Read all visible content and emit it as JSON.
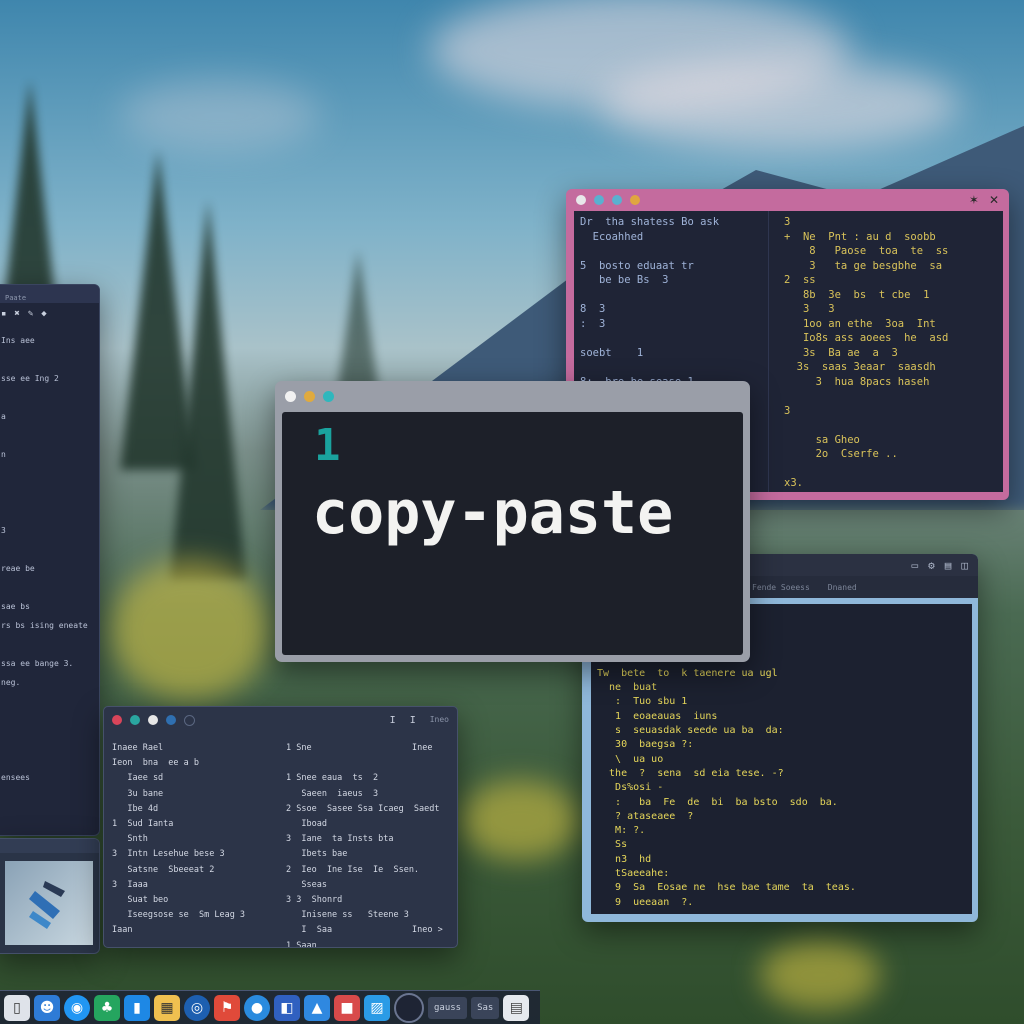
{
  "main_window": {
    "number": "1",
    "title": "copy-paste"
  },
  "colors": {
    "accent_teal": "#1aa39e",
    "pink_frame": "#c46b9e",
    "blue_frame": "#8fb8da",
    "editor_bg": "#1d2029"
  },
  "pink_window": {
    "col1": "Dr  tha shatess Bo ask\n  Ecoahhed\n\n5  bosto eduaat tr\n   be be Bs  3\n\n8  3\n:  3\n\nsoebt    1\n\n8:  bre be sease 1\n3  8 sedgsa  shsa\n   Sea he\n\n3  Sahn",
    "col2": "3\n+  Ne  Pnt : au d  soobb\n    8   Paose  toa  te  ss\n    3   ta ge besgbhe  sa\n2  ss\n   8b  3e  bs  t cbe  1\n   3   3\n   1oo an ethe  3oa  Int\n   Io8s ass aoees  he  asd\n   3s  Ba ae  a  3\n  3s  saas 3eaar  saasdh\n     3  hua 8pacs haseh\n\n3\n\n     sa Gheo\n     2o  Cserfe ..\n\nx3."
  },
  "blue_window": {
    "tabs": [
      "Fende Soeess",
      "Dnaned"
    ],
    "code": "   -   Tea fdr pane.. ?\n  3s   Tse ie  Fe an ba\n  tr  t  ue se\nTw  bete  to  k taenere ua ugl\n  ne  buat\n   :  Tuo sbu 1\n   1  eoaeauas  iuns\n   s  seuasdak seede ua ba  da:\n   30  baegsa ?:\n   \\  ua uo\n  the  ?  sena  sd eia tese. -?\n   Ds%osi -\n   :   ba  Fe  de  bi  ba bsto  sdo  ba.\n   ? ataseaee  ?\n   M: ?.\n   Ss\n   n3  hd\n   tSaeeahe:\n   9  Sa  Eosae ne  hse bae tame  ta  teas.\n   9  ueeaan  ?."
  },
  "list_window": {
    "toolbar": "Ineo",
    "col1": "Inaee Rael\nIeon  bna  ee a b\n   Iaee sd\n   3u bane\n   Ibe 4d\n1  Sud Ianta\n   Snth\n3  Intn Lesehue bese 3\n   Satsne  Sbeeeat 2\n3  Iaaa\n   Suat beo\n   Iseegsose se  Sm Leag 3\nIaan",
    "col2": "1 Sne\n\n1 Snee eaua  ts  2\n   Saeen  iaeus  3\n2 Ssoe  Sasee Ssa Icaeg  Saedt\n   Iboad\n3  Iane  ta Insts bta\n   Ibets bae\n2  Ieo  Ine Ise  Ie  Ssen.\n   Sseas\n3 3  Shonrd\n   Inisene ss   Steene 3\n   I  Saa\n1 Saan",
    "col3": "Inee\n\n\n\n\n\n\n\n\n\n\n\nIneo >"
  },
  "left_window": {
    "title": "Paate",
    "code": "Ins aee\n\nsse ee Ing 2\n\na\n\nn\n\n\n\n3\n\nreae be\n\nsae bs\nrs bs ising eneate\n\nssa ee bange 3.\nneg.\n\n\n\n\nensees"
  },
  "dock": {
    "text_items": [
      "gauss",
      "Sas"
    ]
  }
}
